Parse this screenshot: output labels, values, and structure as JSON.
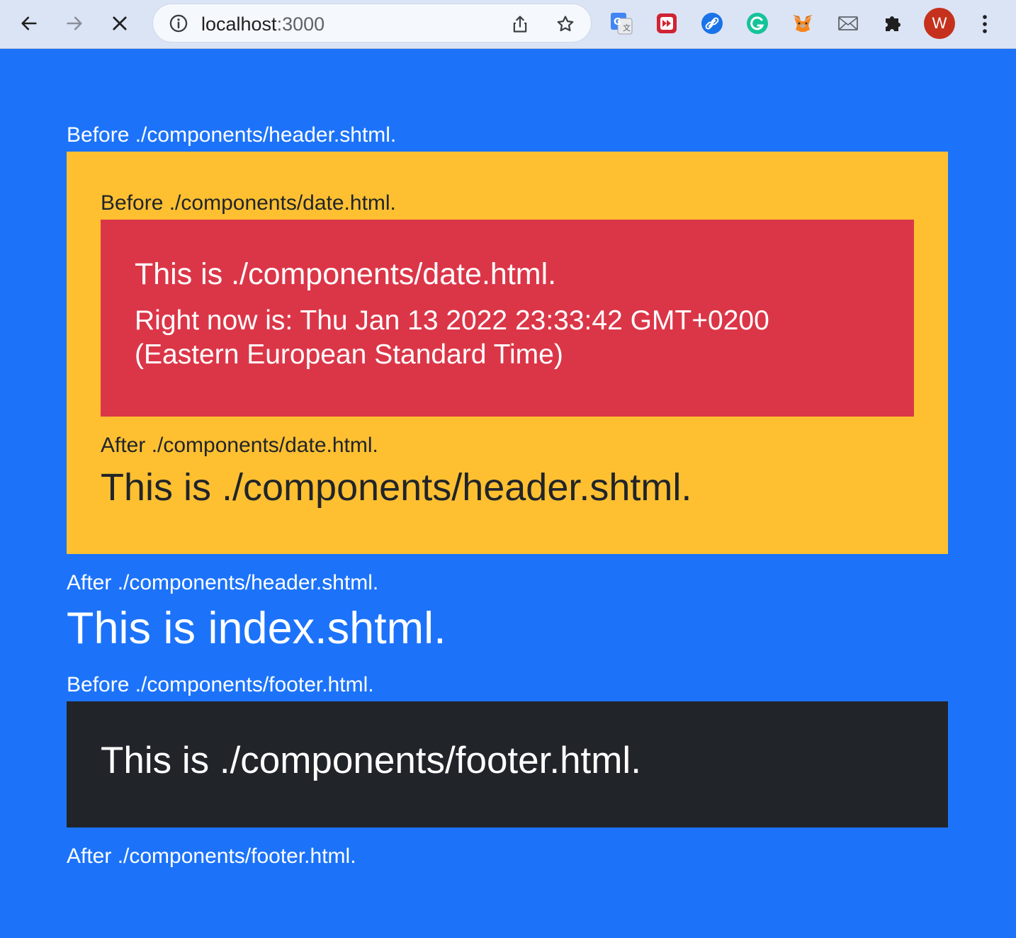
{
  "browser": {
    "url_host": "localhost",
    "url_port": ":3000",
    "avatar_letter": "W",
    "extensions": [
      "google-translate-icon",
      "fast-forward-extension-icon",
      "link-extension-icon",
      "grammarly-icon",
      "metamask-fox-icon",
      "mail-icon",
      "puzzle-icon"
    ]
  },
  "page": {
    "before_header": "Before ./components/header.shtml.",
    "before_date": "Before ./components/date.html.",
    "date_title": "This is ./components/date.html.",
    "date_now_line1": "Right now is: Thu Jan 13 2022 23:33:42 GMT+0200",
    "date_now_line2": "(Eastern European Standard Time)",
    "after_date": "After ./components/date.html.",
    "header_title": "This is ./components/header.shtml.",
    "after_header": "After ./components/header.shtml.",
    "index_title": "This is index.shtml.",
    "before_footer": "Before ./components/footer.html.",
    "footer_title": "This is ./components/footer.html.",
    "after_footer": "After ./components/footer.html."
  },
  "colors": {
    "page_bg": "#1c73fa",
    "header_bg": "#fec031",
    "date_bg": "#db3648",
    "footer_bg": "#212429"
  }
}
